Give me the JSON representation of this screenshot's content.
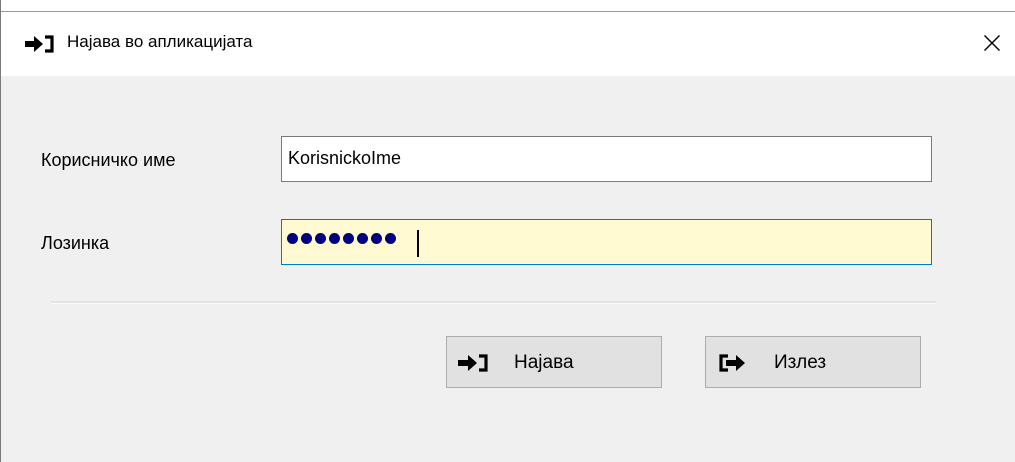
{
  "window": {
    "title": "Најава во апликацијата",
    "title_icon": "sign-in-icon",
    "close_icon": "close-icon"
  },
  "form": {
    "username_label": "Корисничко име",
    "username_value": "KorisnickoIme",
    "password_label": "Лозинка",
    "password_masked": "••••••••",
    "password_length": 8
  },
  "buttons": {
    "login_label": "Најава",
    "login_icon": "sign-in-icon",
    "exit_label": "Излез",
    "exit_icon": "sign-out-icon"
  },
  "colors": {
    "dialog_bg": "#f0f0f0",
    "active_field_bg": "#fffad2",
    "active_field_border": "#0078d7",
    "password_dot": "#00007f",
    "button_bg": "#e1e1e1"
  }
}
